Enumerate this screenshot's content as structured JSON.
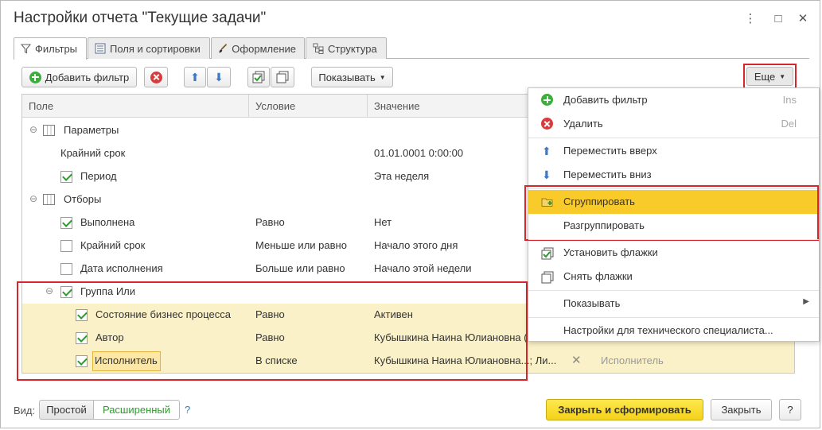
{
  "window": {
    "title": "Настройки отчета \"Текущие задачи\"",
    "more_glyph": "⋮",
    "max_glyph": "□",
    "close_glyph": "✕"
  },
  "tabs": [
    {
      "label": "Фильтры",
      "icon": "filter-icon",
      "active": true
    },
    {
      "label": "Поля и сортировки",
      "icon": "fields-icon",
      "active": false
    },
    {
      "label": "Оформление",
      "icon": "brush-icon",
      "active": false
    },
    {
      "label": "Структура",
      "icon": "structure-icon",
      "active": false
    }
  ],
  "toolbar": {
    "add_filter_label": "Добавить фильтр",
    "show_label": "Показывать",
    "more_label": "Еще"
  },
  "grid": {
    "columns": [
      "Поле",
      "Условие",
      "Значение"
    ],
    "rows": [
      {
        "field": "Параметры",
        "condition": "",
        "value": "",
        "type": "group"
      },
      {
        "field": "Крайний срок",
        "condition": "",
        "value": "01.01.0001 0:00:00",
        "type": "param"
      },
      {
        "field": "Период",
        "condition": "",
        "value": "Эта неделя",
        "type": "param",
        "checked": true
      },
      {
        "field": "Отборы",
        "condition": "",
        "value": "",
        "type": "group"
      },
      {
        "field": "Выполнена",
        "condition": "Равно",
        "value": "Нет",
        "checked": true
      },
      {
        "field": "Крайний срок",
        "condition": "Меньше или равно",
        "value": "Начало этого дня",
        "checked": false
      },
      {
        "field": "Дата исполнения",
        "condition": "Больше или равно",
        "value": "Начало этой недели",
        "checked": false
      },
      {
        "field": "Группа Или",
        "condition": "",
        "value": "",
        "checked": true,
        "type": "or-group"
      },
      {
        "field": "Состояние бизнес процесса",
        "condition": "Равно",
        "value": "Активен",
        "checked": true
      },
      {
        "field": "Автор",
        "condition": "Равно",
        "value": "Кубышкина Наина Юлиановна (",
        "checked": true
      },
      {
        "field": "Исполнитель",
        "condition": "В списке",
        "value": "Кубышкина Наина Юлиановна...; Ли...",
        "checked": true,
        "extra": "Исполнитель"
      }
    ]
  },
  "menu": {
    "items": [
      {
        "label": "Добавить фильтр",
        "shortcut": "Ins",
        "icon": "plus-icon"
      },
      {
        "label": "Удалить",
        "shortcut": "Del",
        "icon": "delete-icon"
      },
      {
        "label": "Переместить вверх",
        "shortcut": "",
        "icon": "arrow-up-icon"
      },
      {
        "label": "Переместить вниз",
        "shortcut": "",
        "icon": "arrow-down-icon"
      },
      {
        "label": "Сгруппировать",
        "shortcut": "",
        "icon": "group-folder-icon",
        "highlighted": true
      },
      {
        "label": "Разгруппировать",
        "shortcut": "",
        "icon": ""
      },
      {
        "label": "Установить флажки",
        "shortcut": "",
        "icon": "check-all-icon"
      },
      {
        "label": "Снять флажки",
        "shortcut": "",
        "icon": "uncheck-all-icon"
      },
      {
        "label": "Показывать",
        "shortcut": "",
        "icon": "",
        "submenu": true
      },
      {
        "label": "Настройки для технического специалиста...",
        "shortcut": "",
        "icon": ""
      }
    ]
  },
  "footer": {
    "view_label": "Вид:",
    "simple_label": "Простой",
    "extended_label": "Расширенный",
    "help_label": "?",
    "generate_label": "Закрыть и сформировать",
    "close_label": "Закрыть",
    "question_label": "?"
  },
  "colors": {
    "accent_yellow": "#f8cb2b",
    "highlight_row": "#fbf1c8",
    "red_frame": "#d6262b",
    "green_check": "#2e9b2e"
  }
}
